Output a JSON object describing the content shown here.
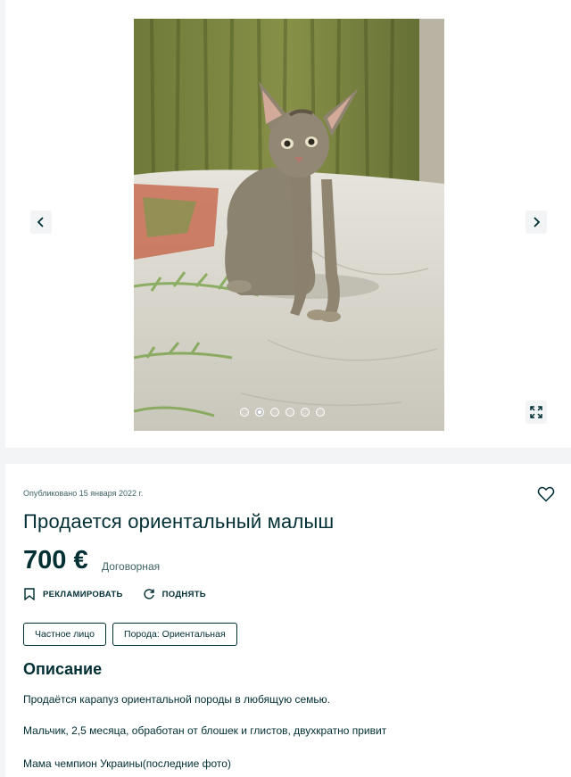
{
  "gallery": {
    "photo_alt": "Oriental kitten sitting on a bed",
    "prev_icon": "chevron-left-icon",
    "next_icon": "chevron-right-icon",
    "expand_icon": "fullscreen-icon",
    "dots_count": 6,
    "active_dot": 1
  },
  "listing": {
    "published": "Опубликовано 15 января 2022 г.",
    "title": "Продается ориентальный малыш",
    "price": "700 €",
    "negotiable": "Договорная",
    "actions": {
      "promote": "РЕКЛАМИРОВАТЬ",
      "raise": "ПОДНЯТЬ"
    },
    "tags": [
      "Частное лицо",
      "Порода: Ориентальная"
    ],
    "description_heading": "Описание",
    "description": [
      "Продаётся карапуз ориентальной породы в любящую семью.",
      "Мальчик, 2,5 месяца, обработан от блошек и глистов, двухкратно привит",
      "Мама чемпион Украины(последние фото)"
    ]
  },
  "colors": {
    "text": "#002f34",
    "muted": "#406367",
    "background": "#f2f4f5"
  }
}
